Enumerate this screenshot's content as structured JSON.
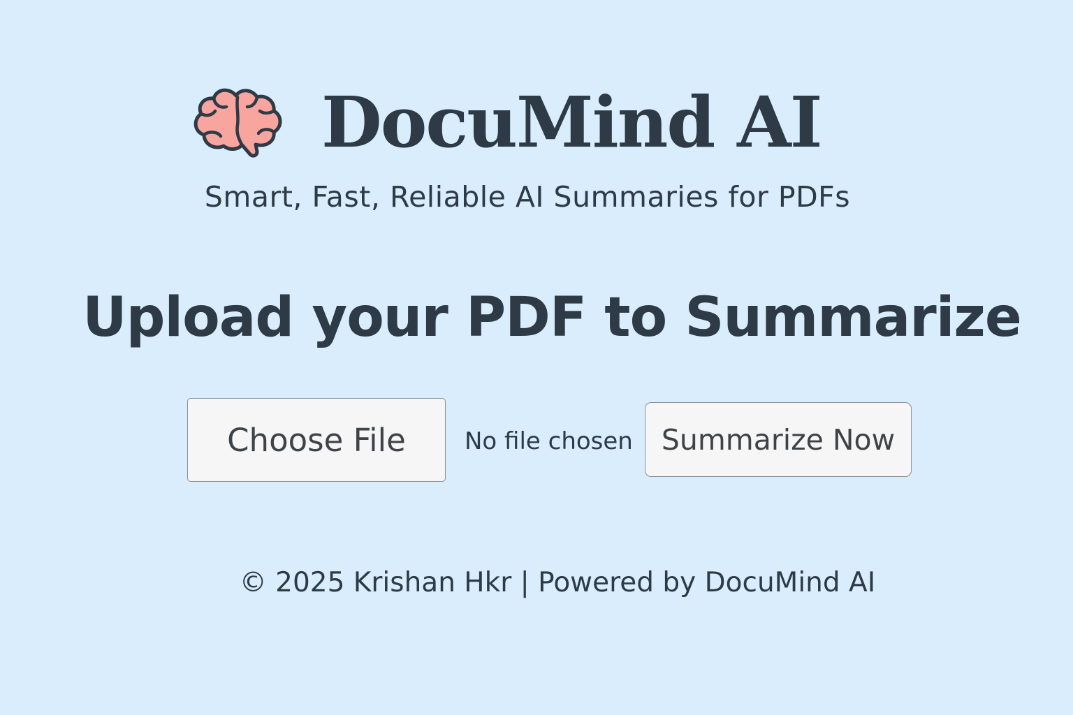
{
  "header": {
    "logo_icon": "brain-icon",
    "title": "DocuMind AI",
    "tagline": "Smart, Fast, Reliable AI Summaries for PDFs"
  },
  "upload": {
    "heading": "Upload your PDF to Summarize",
    "choose_file_label": "Choose File",
    "file_status": "No file chosen",
    "submit_label": "Summarize Now"
  },
  "footer": {
    "text": "© 2025 Krishan Hkr | Powered by DocuMind AI"
  },
  "colors": {
    "background": "#d9edfc",
    "text": "#2e3a45",
    "brain_fill": "#f7a59e",
    "button_bg": "#f6f6f6"
  }
}
